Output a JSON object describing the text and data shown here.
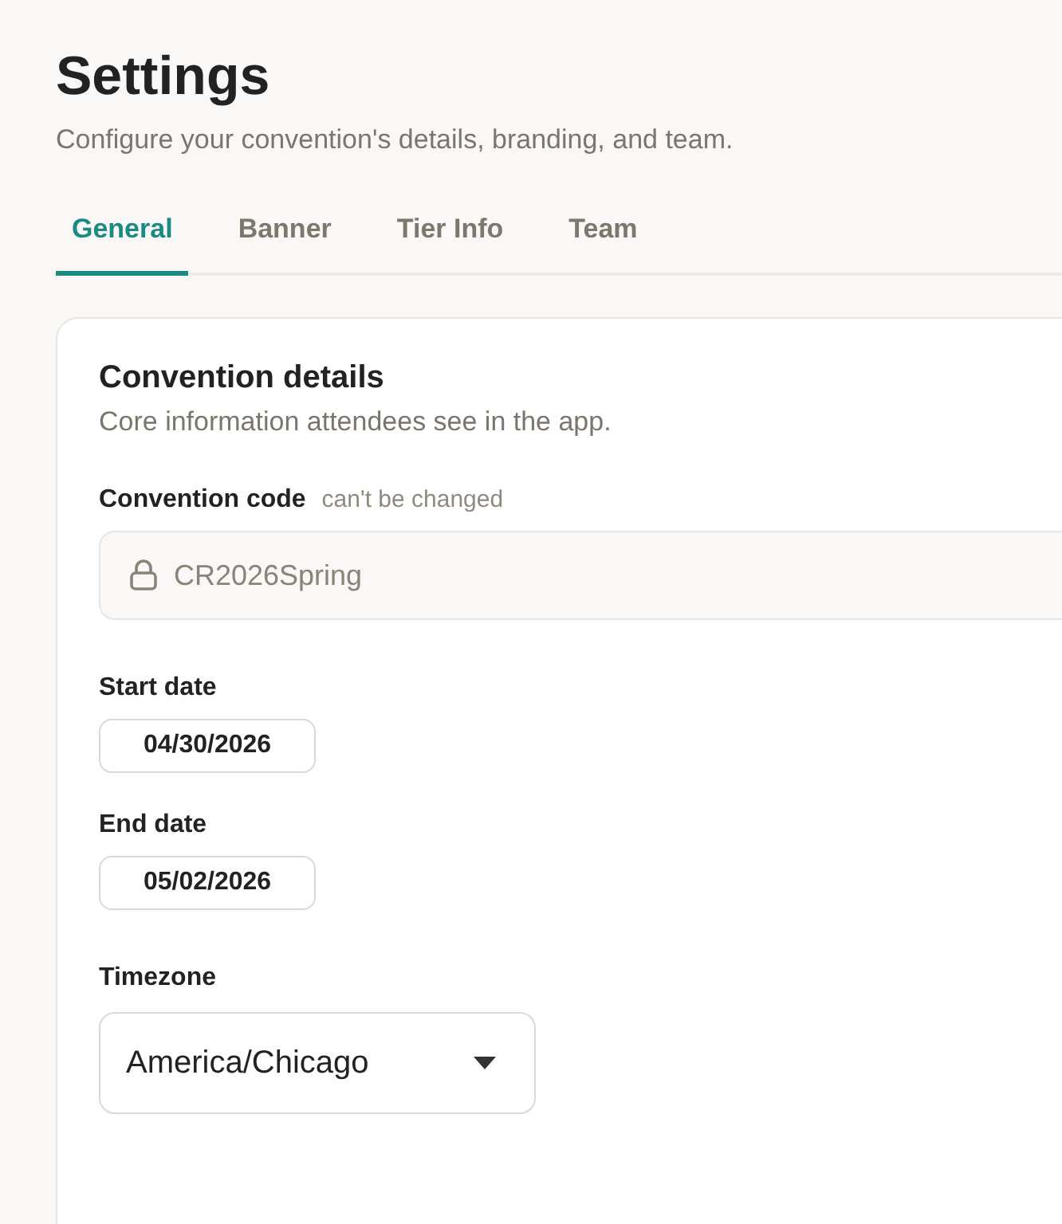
{
  "header": {
    "title": "Settings",
    "subtitle": "Configure your convention's details, branding, and team."
  },
  "tabs": [
    {
      "label": "General",
      "selected": true
    },
    {
      "label": "Banner",
      "selected": false
    },
    {
      "label": "Tier Info",
      "selected": false
    },
    {
      "label": "Team",
      "selected": false
    }
  ],
  "card": {
    "title": "Convention details",
    "subtitle": "Core information attendees see in the app.",
    "code": {
      "label": "Convention code",
      "hint": "can't be changed",
      "value": "CR2026Spring",
      "disabled": true
    },
    "start_date": {
      "label": "Start date",
      "value": "04/30/2026"
    },
    "end_date": {
      "label": "End date",
      "value": "05/02/2026"
    },
    "timezone": {
      "label": "Timezone",
      "value": "America/Chicago"
    }
  }
}
